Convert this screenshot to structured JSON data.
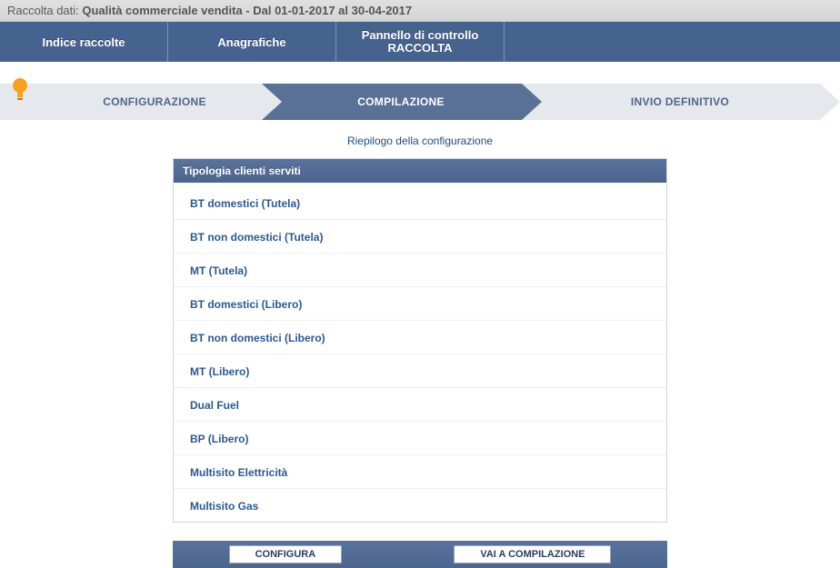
{
  "header": {
    "prefix": "Raccolta dati: ",
    "title_bold": "Qualità commerciale vendita - Dal 01-01-2017 al 30-04-2017"
  },
  "top_nav": {
    "items": [
      {
        "label": "Indice raccolte"
      },
      {
        "label": "Anagrafiche"
      },
      {
        "line1": "Pannello di controllo",
        "line2": "RACCOLTA"
      }
    ]
  },
  "steps": {
    "config": "CONFIGURAZIONE",
    "compile": "COMPILAZIONE",
    "send": "INVIO DEFINITIVO"
  },
  "summary_link": "Riepilogo della configurazione",
  "panel": {
    "header": "Tipologia clienti serviti",
    "items": [
      "BT domestici (Tutela)",
      "BT non domestici (Tutela)",
      "MT (Tutela)",
      "BT domestici (Libero)",
      "BT non domestici (Libero)",
      "MT (Libero)",
      "Dual Fuel",
      "BP (Libero)",
      "Multisito Elettricità",
      "Multisito Gas"
    ]
  },
  "actions": {
    "configure": "CONFIGURA",
    "compile": "VAI A COMPILAZIONE"
  }
}
